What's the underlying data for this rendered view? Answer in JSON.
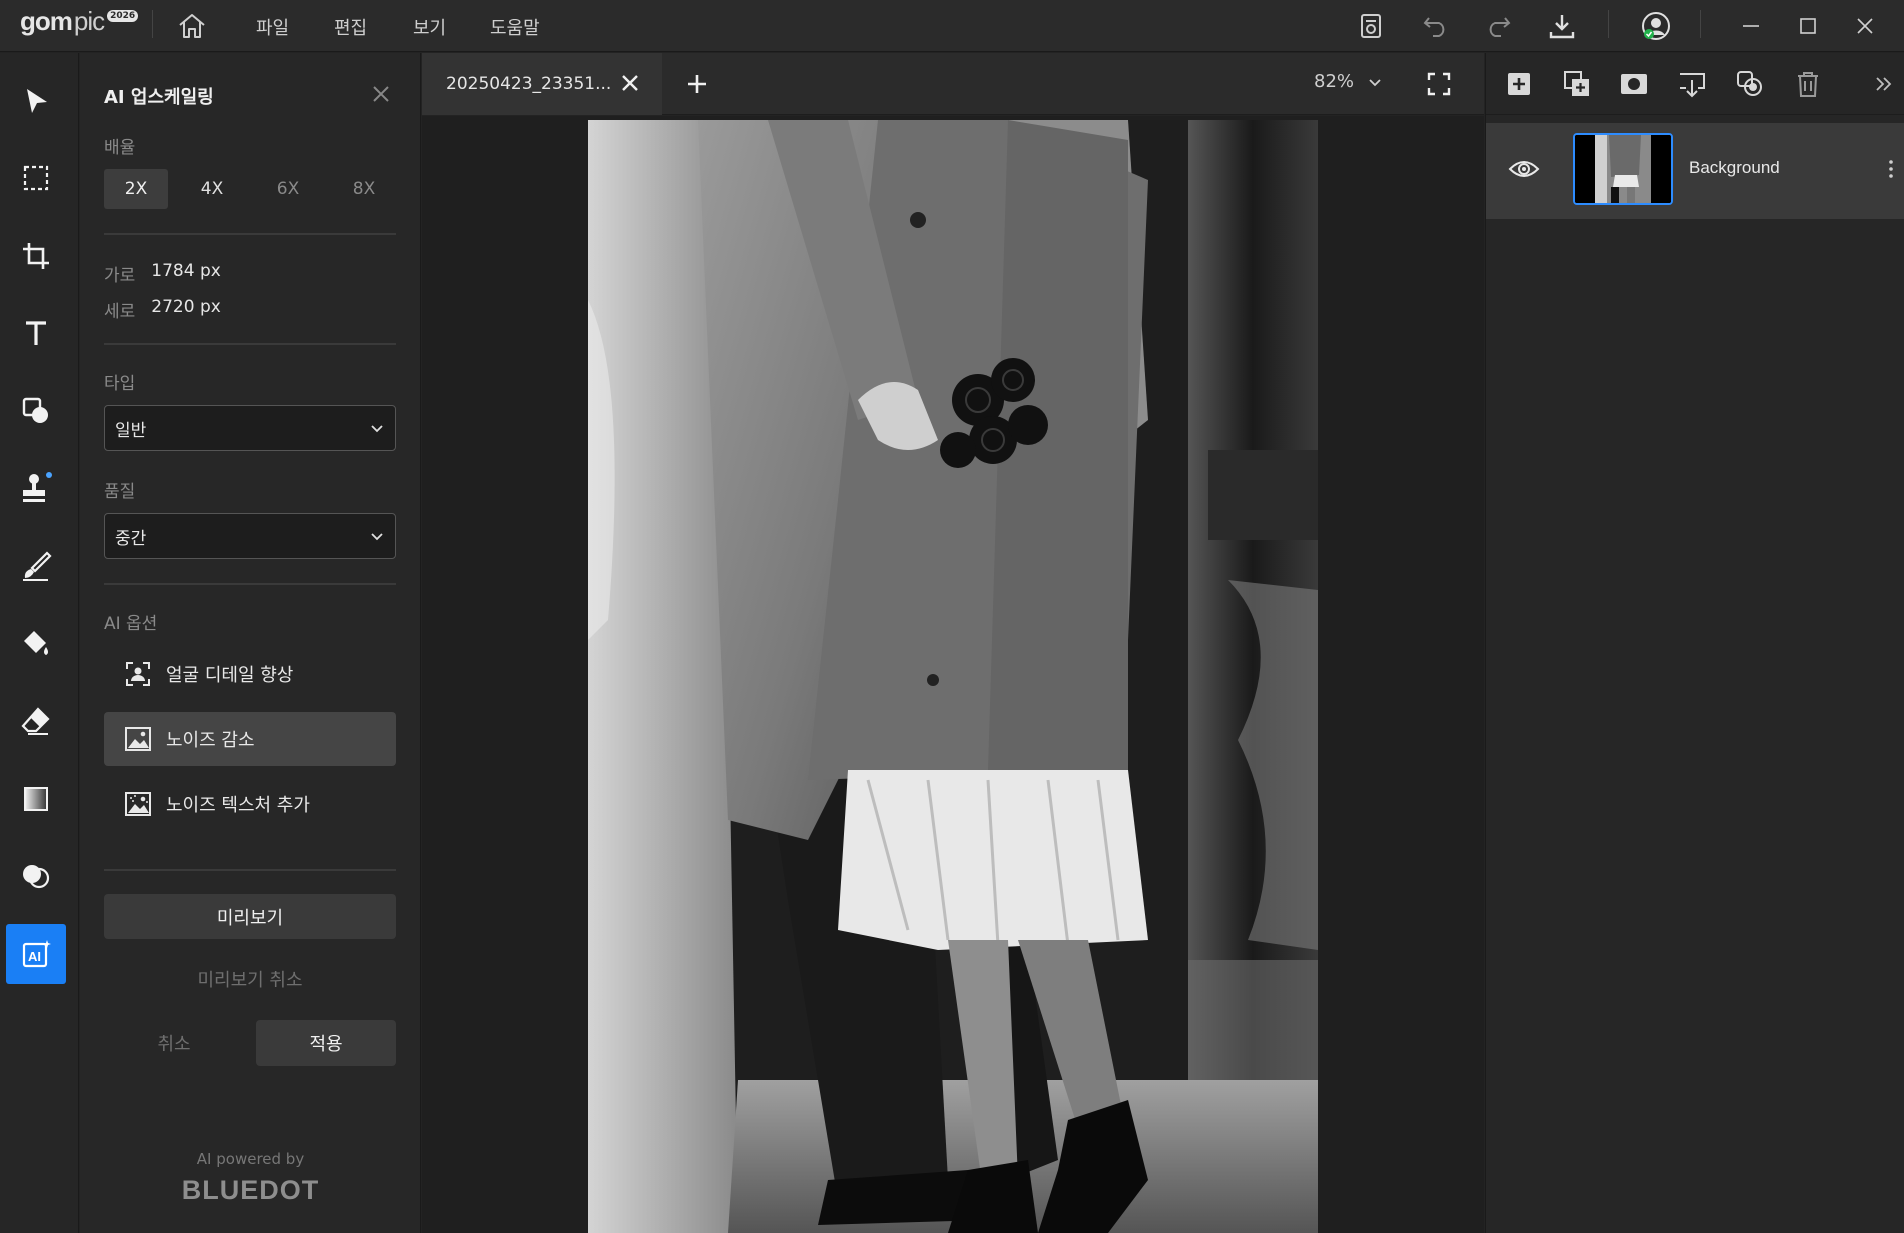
{
  "app": {
    "logo_main": "gom",
    "logo_sub": "pic",
    "logo_badge": "2026"
  },
  "menu": {
    "items": [
      "파일",
      "편집",
      "보기",
      "도움말"
    ]
  },
  "left_panel": {
    "title": "AI 업스케일링",
    "scale_label": "배율",
    "scale_options": [
      "2X",
      "4X",
      "6X",
      "8X"
    ],
    "scale_selected": "2X",
    "width_label": "가로",
    "width_value": "1784 px",
    "height_label": "세로",
    "height_value": "2720 px",
    "type_label": "타입",
    "type_value": "일반",
    "quality_label": "품질",
    "quality_value": "중간",
    "ai_options_label": "AI 옵션",
    "ai_options": [
      {
        "label": "얼굴 디테일 향상",
        "icon": "face-scan-icon",
        "selected": false
      },
      {
        "label": "노이즈 감소",
        "icon": "image-icon",
        "selected": true
      },
      {
        "label": "노이즈 텍스처 추가",
        "icon": "image-noise-icon",
        "selected": false
      }
    ],
    "preview_button": "미리보기",
    "preview_cancel": "미리보기 취소",
    "cancel_button": "취소",
    "apply_button": "적용",
    "powered_by": "AI powered by",
    "powered_brand": "BLUEDOT"
  },
  "document": {
    "tab_title": "20250423_23351...",
    "zoom": "82%"
  },
  "layers": {
    "items": [
      {
        "name": "Background",
        "visible": true,
        "selected": true
      }
    ]
  },
  "colors": {
    "accent": "#1a7ff5",
    "background": "#232323",
    "panel": "#272727"
  }
}
